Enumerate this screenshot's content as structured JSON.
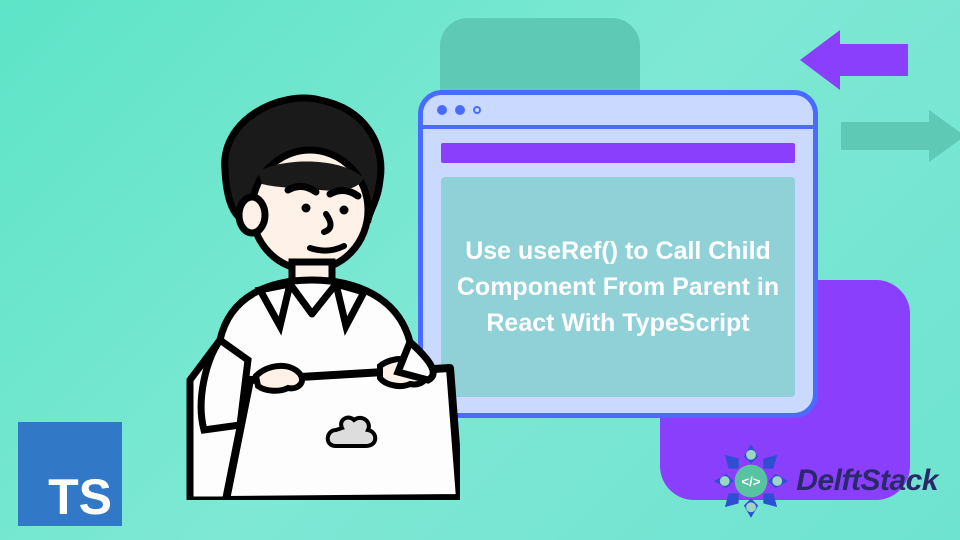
{
  "hero": {
    "title": "Use useRef() to Call Child Component From Parent in React With TypeScript"
  },
  "badges": {
    "typescript": "TS"
  },
  "brand": {
    "name": "DelftStack"
  },
  "colors": {
    "accent_purple": "#8a3ffc",
    "accent_blue": "#4a6bff",
    "accent_teal": "#5ecab5",
    "ts_blue": "#3178c6"
  }
}
